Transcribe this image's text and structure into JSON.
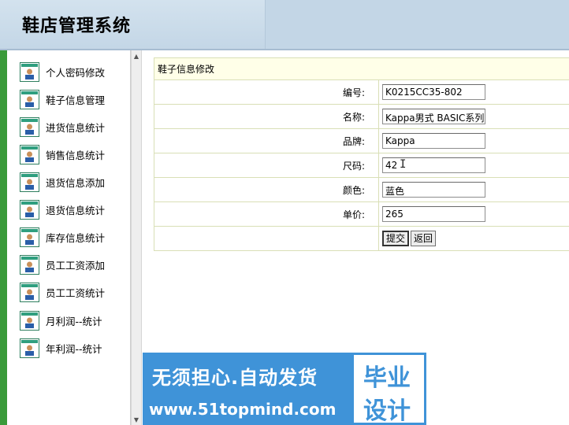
{
  "header": {
    "title": "鞋店管理系统"
  },
  "sidebar": {
    "items": [
      {
        "label": "个人密码修改"
      },
      {
        "label": "鞋子信息管理"
      },
      {
        "label": "进货信息统计"
      },
      {
        "label": "销售信息统计"
      },
      {
        "label": "退货信息添加"
      },
      {
        "label": "退货信息统计"
      },
      {
        "label": "库存信息统计"
      },
      {
        "label": "员工工资添加"
      },
      {
        "label": "员工工资统计"
      },
      {
        "label": "月利润--统计"
      },
      {
        "label": "年利润--统计"
      }
    ],
    "icon": "user-card-icon"
  },
  "form": {
    "caption": "鞋子信息修改",
    "fields": [
      {
        "label": "编号:",
        "value": "K0215CC35-802"
      },
      {
        "label": "名称:",
        "value": "Kappa男式 BASIC系列"
      },
      {
        "label": "品牌:",
        "value": "Kappa"
      },
      {
        "label": "尺码:",
        "value": "42"
      },
      {
        "label": "颜色:",
        "value": "蓝色"
      },
      {
        "label": "单价:",
        "value": "265"
      }
    ],
    "submit_label": "提交",
    "back_label": "返回"
  },
  "watermark": {
    "line1": "无须担心.自动发货",
    "line2": "www.51topmind.com",
    "badge1": "毕业",
    "badge2": "设计"
  },
  "colors": {
    "header_bg": "#c3d6e6",
    "accent_green": "#3a9a3a",
    "table_border": "#d9dfb6",
    "caption_bg": "#ffffe8",
    "watermark_blue": "#3f93d8"
  }
}
